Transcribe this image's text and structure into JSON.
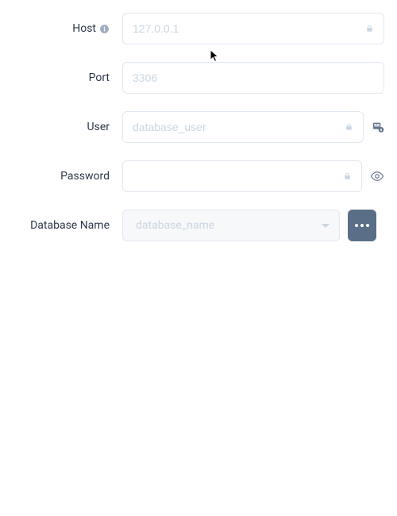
{
  "labels": {
    "host": "Host",
    "port": "Port",
    "user": "User",
    "password": "Password",
    "database": "Database Name"
  },
  "placeholders": {
    "host": "127.0.0.1",
    "port": "3306",
    "user": "database_user",
    "password": "",
    "database": "database_name"
  },
  "values": {
    "host": "",
    "port": "",
    "user": "",
    "password": "",
    "database": ""
  },
  "icons": {
    "info": "info-icon",
    "lock": "lock-icon",
    "sid": "sid-icon",
    "eye": "eye-icon",
    "more": "more-icon",
    "caret": "caret-icon"
  },
  "colors": {
    "action_button_bg": "#5a6f87",
    "border": "#e2e8f0",
    "placeholder": "#cbd5e0",
    "label": "#2d3748"
  }
}
